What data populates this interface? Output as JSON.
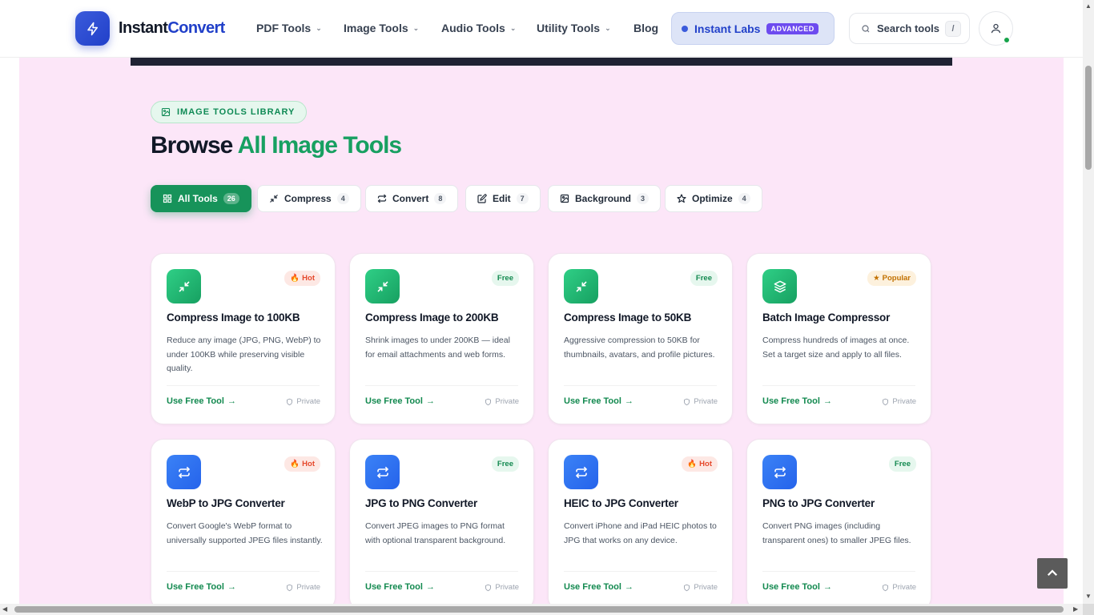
{
  "brand": {
    "name_part1": "Instant",
    "name_part2": "Convert",
    "icon": "lightning-icon"
  },
  "nav": {
    "items": [
      {
        "label": "PDF Tools",
        "has_dropdown": true
      },
      {
        "label": "Image Tools",
        "has_dropdown": true
      },
      {
        "label": "Audio Tools",
        "has_dropdown": true
      },
      {
        "label": "Utility Tools",
        "has_dropdown": true
      },
      {
        "label": "Blog",
        "has_dropdown": false
      }
    ],
    "labs": {
      "label": "Instant Labs",
      "badge": "ADVANCED"
    },
    "search": {
      "placeholder": "Search tools",
      "shortcut": "/"
    },
    "user_icon": "user-icon"
  },
  "hero": {
    "badge": "IMAGE TOOLS LIBRARY",
    "title_part1": "Browse",
    "title_part2": "All Image Tools"
  },
  "filters": [
    {
      "label": "All Tools",
      "count": "26",
      "icon": "grid-icon",
      "active": true
    },
    {
      "label": "Compress",
      "count": "4",
      "icon": "compress-icon",
      "active": false
    },
    {
      "label": "Convert",
      "count": "8",
      "icon": "convert-icon",
      "active": false
    },
    {
      "label": "Edit",
      "count": "7",
      "icon": "edit-icon",
      "active": false
    },
    {
      "label": "Background",
      "count": "3",
      "icon": "image-icon",
      "active": false
    },
    {
      "label": "Optimize",
      "count": "4",
      "icon": "star-icon",
      "active": false
    }
  ],
  "cards": [
    {
      "title": "Compress Image to 100KB",
      "tag": "Hot",
      "tag_type": "hot",
      "icon": "compress-icon",
      "color": "green",
      "desc": "Reduce any image (JPG, PNG, WebP) to under 100KB while preserving visible quality.",
      "cta": "Use Free Tool",
      "privacy": "Private"
    },
    {
      "title": "Compress Image to 200KB",
      "tag": "Free",
      "tag_type": "free",
      "icon": "compress-icon",
      "color": "green",
      "desc": "Shrink images to under 200KB — ideal for email attachments and web forms.",
      "cta": "Use Free Tool",
      "privacy": "Private"
    },
    {
      "title": "Compress Image to 50KB",
      "tag": "Free",
      "tag_type": "free",
      "icon": "compress-icon",
      "color": "green",
      "desc": "Aggressive compression to 50KB for thumbnails, avatars, and profile pictures.",
      "cta": "Use Free Tool",
      "privacy": "Private"
    },
    {
      "title": "Batch Image Compressor",
      "tag": "Popular",
      "tag_type": "popular",
      "icon": "layers-icon",
      "color": "green",
      "desc": "Compress hundreds of images at once. Set a target size and apply to all files.",
      "cta": "Use Free Tool",
      "privacy": "Private"
    },
    {
      "title": "WebP to JPG Converter",
      "tag": "Hot",
      "tag_type": "hot",
      "icon": "convert-icon",
      "color": "blue",
      "desc": "Convert Google's WebP format to universally supported JPEG files instantly.",
      "cta": "Use Free Tool",
      "privacy": "Private"
    },
    {
      "title": "JPG to PNG Converter",
      "tag": "Free",
      "tag_type": "free",
      "icon": "convert-icon",
      "color": "blue",
      "desc": "Convert JPEG images to PNG format with optional transparent background.",
      "cta": "Use Free Tool",
      "privacy": "Private"
    },
    {
      "title": "HEIC to JPG Converter",
      "tag": "Hot",
      "tag_type": "hot",
      "icon": "convert-icon",
      "color": "blue",
      "desc": "Convert iPhone and iPad HEIC photos to JPG that works on any device.",
      "cta": "Use Free Tool",
      "privacy": "Private"
    },
    {
      "title": "PNG to JPG Converter",
      "tag": "Free",
      "tag_type": "free",
      "icon": "convert-icon",
      "color": "blue",
      "desc": "Convert PNG images (including transparent ones) to smaller JPEG files.",
      "cta": "Use Free Tool",
      "privacy": "Private"
    }
  ],
  "colors": {
    "accent_green": "#17a061",
    "brand_blue": "#2140c9",
    "labs_purple": "#6d4bef",
    "page_pink": "#fce6f8"
  }
}
